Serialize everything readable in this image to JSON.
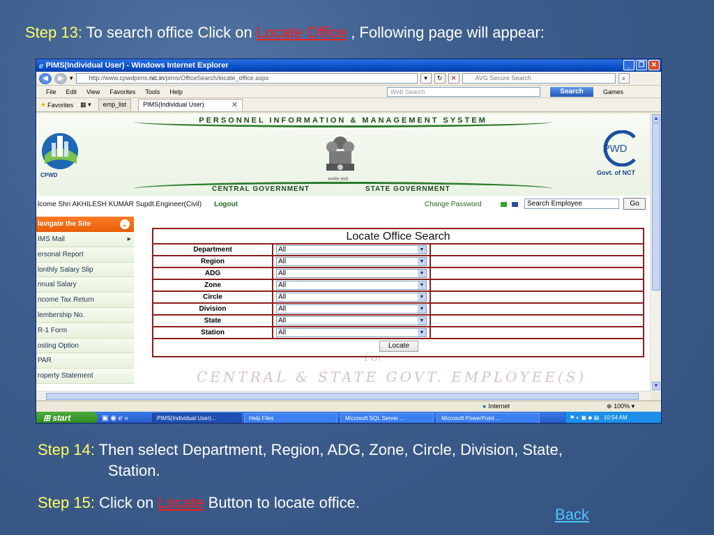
{
  "slide": {
    "title_step": "Step 13:",
    "title_pre": "To search office Click on",
    "title_link": "Locate Office",
    "title_post": ", Following page will appear:",
    "step14_label": "Step 14:",
    "step14_text": "Then select Department, Region, ADG, Zone, Circle, Division, State,",
    "step14_text2": "Station.",
    "step15_label": "Step 15:",
    "step15_pre": "Click on",
    "step15_link": "Locate",
    "step15_post": "Button to locate office.",
    "back_link": "Back"
  },
  "browser": {
    "window_title": "PIMS(Individual User) - Windows Internet Explorer",
    "url_prefix": "http://www.cpwdpims.",
    "url_host": "nic.in",
    "url_path": "/pims/OfficeSearch/locate_office.aspx",
    "secure_search": "AVG Secure Search",
    "menu": [
      "File",
      "Edit",
      "View",
      "Favorites",
      "Tools",
      "Help"
    ],
    "web_search_placeholder": "Web Search",
    "search_label": "Search",
    "games_label": "Games",
    "favorites_label": "Favorites",
    "tab_emp": "emp_list",
    "tab_active": "PIMS(Individual User)",
    "status_zone": "Internet",
    "zoom": "100%"
  },
  "site": {
    "banner": "PERSONNEL INFORMATION & MANAGEMENT SYSTEM",
    "cpwd_label": "CPWD",
    "emblem_caption": "सत्यमेव जयते",
    "pwd_label": "PWD",
    "pwd_sub": "Govt. of NCT",
    "central_gov": "CENTRAL GOVERNMENT",
    "state_gov": "STATE GOVERNMENT",
    "welcome": "lcome Shri AKHILESH KUMAR Supdt.Engineer(Civil)",
    "logout": "Logout",
    "change_password": "Change Password",
    "employee_search": "Search Employee",
    "go": "Go"
  },
  "sidebar": {
    "header": "lavigate the Site",
    "items": [
      {
        "label": "IMS Mail",
        "has_arrow": true
      },
      {
        "label": "ersonal Report"
      },
      {
        "label": "lonthly Salary Slip"
      },
      {
        "label": "nnual Salary"
      },
      {
        "label": "ncome Tax Return"
      },
      {
        "label": "lembership No."
      },
      {
        "label": "R-1 Form"
      },
      {
        "label": "osting Option"
      },
      {
        "label": "PAR"
      },
      {
        "label": "roperty Statement"
      }
    ]
  },
  "form": {
    "title": "Locate Office Search",
    "fields": [
      {
        "label": "Department",
        "value": "All"
      },
      {
        "label": "Region",
        "value": "All"
      },
      {
        "label": "ADG",
        "value": "All"
      },
      {
        "label": "Zone",
        "value": "All"
      },
      {
        "label": "Circle",
        "value": "All"
      },
      {
        "label": "Division",
        "value": "All"
      },
      {
        "label": "State",
        "value": "All"
      },
      {
        "label": "Station",
        "value": "All"
      }
    ],
    "locate_button": "Locate"
  },
  "watermark": {
    "for_text": "For",
    "line": "CENTRAL & STATE GOVT. EMPLOYEE(S)"
  },
  "taskbar": {
    "start": "start",
    "tasks": [
      "PIMS(Individual User)...",
      "Help Files",
      "Microsoft SQL Server ...",
      "Microsoft PowerPoint ..."
    ],
    "time": "10:54 AM"
  }
}
